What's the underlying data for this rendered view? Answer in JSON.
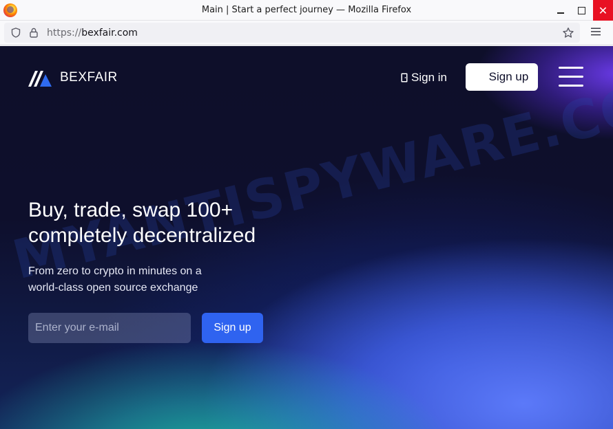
{
  "browser": {
    "window_title": "Main | Start a perfect journey — Mozilla Firefox",
    "url_protocol": "https://",
    "url_host": "bexfair.com",
    "window_buttons": {
      "minimize": "–",
      "maximize": "□",
      "close": "✕"
    }
  },
  "site": {
    "brand_name": "BEXFAIR",
    "nav": {
      "signin_label": "Sign in",
      "signup_label": "Sign up"
    },
    "hero": {
      "title_line1": "Buy, trade, swap 100+",
      "title_line2": "completely decentralized",
      "subtitle_line1": "From zero to crypto in minutes on a",
      "subtitle_line2": "world-class open source exchange",
      "email_placeholder": "Enter your e-mail",
      "signup_label": "Sign up"
    },
    "watermark": "MYANTISPYWARE.COM"
  },
  "colors": {
    "page_bg": "#0e0f2a",
    "accent_button": "#2f63f0",
    "close_button": "#e81123"
  },
  "icons": [
    "firefox-logo-icon",
    "shield-icon",
    "lock-icon",
    "star-icon",
    "menu-icon",
    "bexfair-logo-icon",
    "door-icon",
    "hamburger-icon"
  ]
}
